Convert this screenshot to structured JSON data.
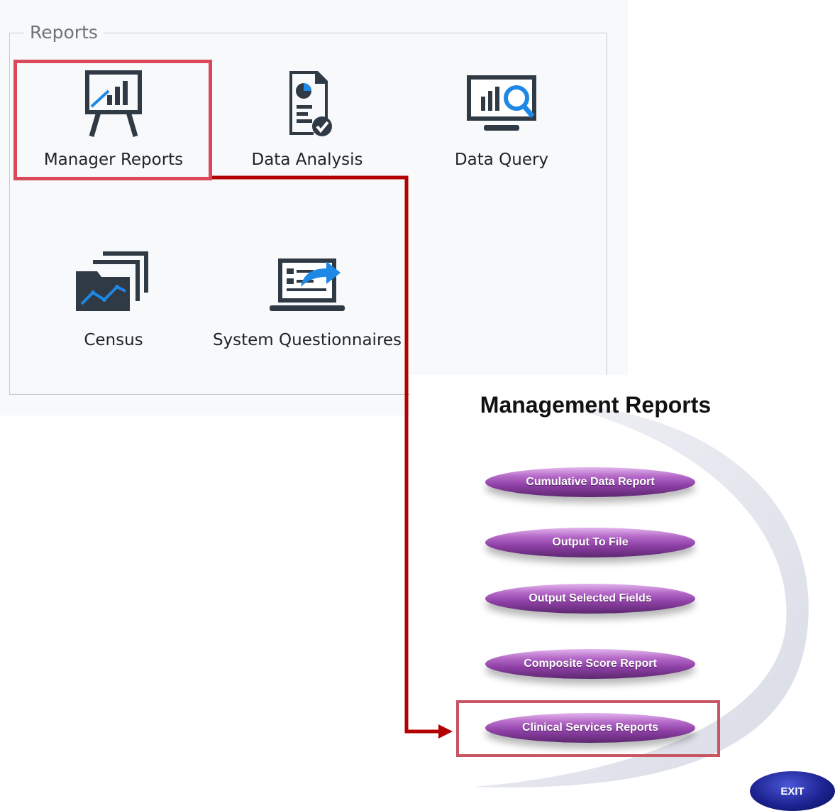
{
  "reports": {
    "legend": "Reports",
    "tiles": [
      {
        "label": "Manager Reports",
        "icon": "presentation-board-icon"
      },
      {
        "label": "Data Analysis",
        "icon": "report-document-icon"
      },
      {
        "label": "Data Query",
        "icon": "monitor-search-chart-icon"
      },
      {
        "label": "Census",
        "icon": "stacked-folders-chart-icon"
      },
      {
        "label": "System Questionnaires",
        "icon": "laptop-share-icon"
      }
    ]
  },
  "management": {
    "title": "Management Reports",
    "buttons": [
      {
        "label": "Cumulative Data Report"
      },
      {
        "label": "Output To File"
      },
      {
        "label": "Output Selected Fields"
      },
      {
        "label": "Composite Score Report"
      },
      {
        "label": "Clinical Services Reports"
      }
    ],
    "exit_label": "EXIT"
  },
  "colors": {
    "highlight": "#d9495a",
    "connector": "#b30000",
    "pill": "#8f40a6",
    "icon_dark": "#2f3a45",
    "icon_blue": "#1e88e5"
  }
}
